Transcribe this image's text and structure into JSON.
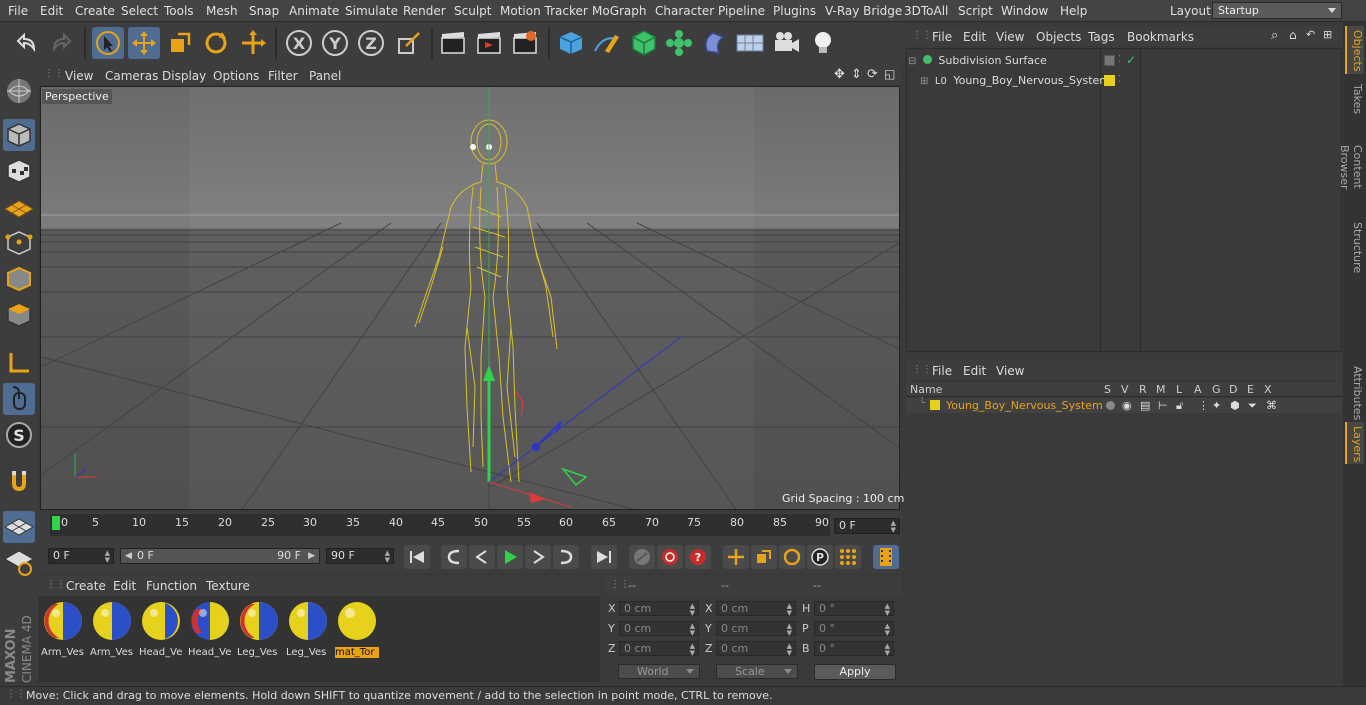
{
  "menu": {
    "items": [
      "File",
      "Edit",
      "Create",
      "Select",
      "Tools",
      "Mesh",
      "Snap",
      "Animate",
      "Simulate",
      "Render",
      "Sculpt",
      "Motion Tracker",
      "MoGraph",
      "Character",
      "Pipeline",
      "Plugins",
      "V-Ray Bridge",
      "3DToAll",
      "Script",
      "Window",
      "Help"
    ],
    "layout_label": "Layout:",
    "layout_value": "Startup"
  },
  "viewport": {
    "menu": [
      "View",
      "Cameras",
      "Display",
      "Options",
      "Filter",
      "Panel"
    ],
    "label": "Perspective",
    "grid_spacing": "Grid Spacing : 100 cm"
  },
  "timeline": {
    "ticks": [
      "0",
      "5",
      "10",
      "15",
      "20",
      "25",
      "30",
      "35",
      "40",
      "45",
      "50",
      "55",
      "60",
      "65",
      "70",
      "75",
      "80",
      "85",
      "90"
    ],
    "current_frame": "0 F"
  },
  "transport": {
    "start_field": "0 F",
    "range_start": "0 F",
    "range_end": "90 F",
    "end_field": "90 F"
  },
  "materials": {
    "menu": [
      "Create",
      "Edit",
      "Function",
      "Texture"
    ],
    "items": [
      {
        "label": "Arm_Ves",
        "style": "blue"
      },
      {
        "label": "Arm_Ves",
        "style": "blue2"
      },
      {
        "label": "Head_Ve",
        "style": "yellowblue"
      },
      {
        "label": "Head_Ve",
        "style": "blue"
      },
      {
        "label": "Leg_Ves",
        "style": "blue"
      },
      {
        "label": "Leg_Ves",
        "style": "blue2"
      },
      {
        "label": "mat_Tor",
        "style": "yellow"
      }
    ]
  },
  "coordinates": {
    "headers": [
      "--",
      "--",
      "--"
    ],
    "rows": [
      {
        "l1": "X",
        "v1": "0 cm",
        "l2": "X",
        "v2": "0 cm",
        "l3": "H",
        "v3": "0 °"
      },
      {
        "l1": "Y",
        "v1": "0 cm",
        "l2": "Y",
        "v2": "0 cm",
        "l3": "P",
        "v3": "0 °"
      },
      {
        "l1": "Z",
        "v1": "0 cm",
        "l2": "Z",
        "v2": "0 cm",
        "l3": "B",
        "v3": "0 °"
      }
    ],
    "space": "World",
    "mode": "Scale",
    "apply": "Apply"
  },
  "objects": {
    "menu": [
      "File",
      "Edit",
      "View",
      "Objects",
      "Tags",
      "Bookmarks"
    ],
    "items": [
      "Subdivision Surface",
      "Young_Boy_Nervous_System"
    ]
  },
  "layers": {
    "menu": [
      "File",
      "Edit",
      "View"
    ],
    "columns": [
      "Name",
      "S",
      "V",
      "R",
      "M",
      "L",
      "A",
      "G",
      "D",
      "E",
      "X"
    ],
    "row_name": "Young_Boy_Nervous_System"
  },
  "right_tabs": [
    "Objects",
    "Takes",
    "Content Browser",
    "Structure",
    "Attributes",
    "Layers"
  ],
  "status": "Move: Click and drag to move elements. Hold down SHIFT to quantize movement / add to the selection in point mode, CTRL to remove.",
  "brand": {
    "maxon": "MAXON",
    "cinema": "CINEMA 4D"
  },
  "colors": {
    "accent": "#e8a317",
    "active_tool": "#4f6c93",
    "layer_yellow": "#e6d21c"
  }
}
